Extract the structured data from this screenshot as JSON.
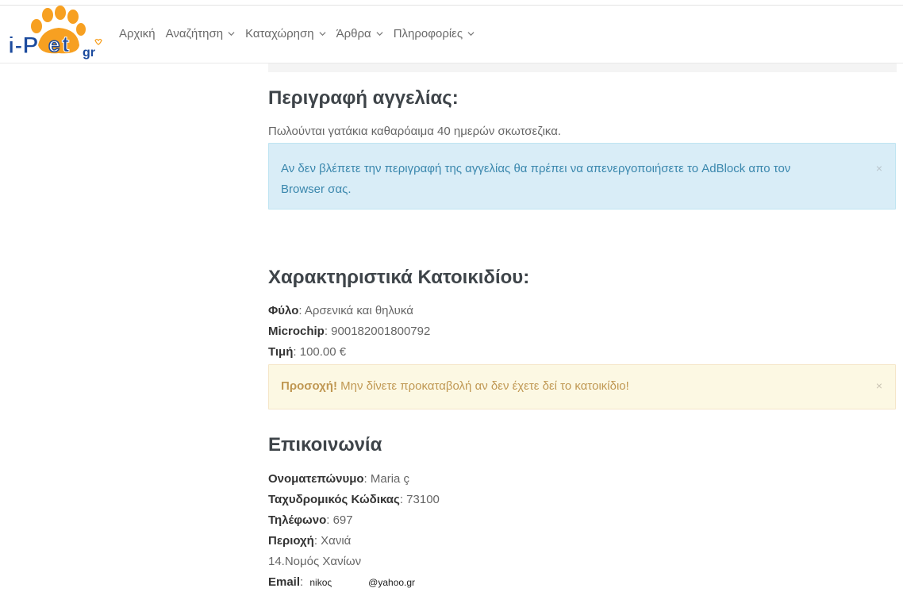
{
  "header": {
    "logo_text": "i-Pet.gr",
    "nav": [
      {
        "label": "Αρχική",
        "has_dropdown": false
      },
      {
        "label": "Αναζήτηση",
        "has_dropdown": true
      },
      {
        "label": "Καταχώρηση",
        "has_dropdown": true
      },
      {
        "label": "Άρθρα",
        "has_dropdown": true
      },
      {
        "label": "Πληροφορίες",
        "has_dropdown": true
      }
    ]
  },
  "description": {
    "heading": "Περιγραφή αγγελίας:",
    "text": "Πωλούνται γατάκια καθαρόαιμα 40 ημερών σκωτσεζικα.",
    "adblock_alert": {
      "line1": "Αν δεν βλέπετε την περιγραφή της αγγελίας θα πρέπει να απενεργοποιήσετε το AdBlock απο τον",
      "line2": "Browser σας.",
      "close": "×"
    }
  },
  "features": {
    "heading": "Χαρακτηριστικά Κατοικιδίου:",
    "fields": [
      {
        "label": "Φύλο",
        "value": ": Αρσενικά και θηλυκά"
      },
      {
        "label": "Microchip",
        "value": ": 900182001800792"
      },
      {
        "label": "Τιμή",
        "value": ": 100.00 €"
      }
    ],
    "warning_alert": {
      "strong": "Προσοχή!",
      "text": " Μην δίνετε προκαταβολή αν δεν έχετε δεί το κατοικίδιο!",
      "close": "×"
    }
  },
  "contact": {
    "heading": "Επικοινωνία",
    "fields": [
      {
        "label": "Ονοματεπώνυμο",
        "value": ": Maria ç"
      },
      {
        "label": "Ταχυδρομικός Κώδικας",
        "value": ": 73100"
      },
      {
        "label": "Τηλέφωνο",
        "value": ": 697"
      },
      {
        "label": "Περιοχή",
        "value": ": Χανιά"
      }
    ],
    "region_line": "14.Νομός Χανίων",
    "email": {
      "label": "Email",
      "value_start": "nikoς",
      "value_end": "@yahoo.gr"
    }
  },
  "colors": {
    "logo_orange": "#f7a021",
    "logo_blue": "#1c4b9e",
    "info_bg": "#d9edf7",
    "warn_bg": "#fcf8e3"
  }
}
